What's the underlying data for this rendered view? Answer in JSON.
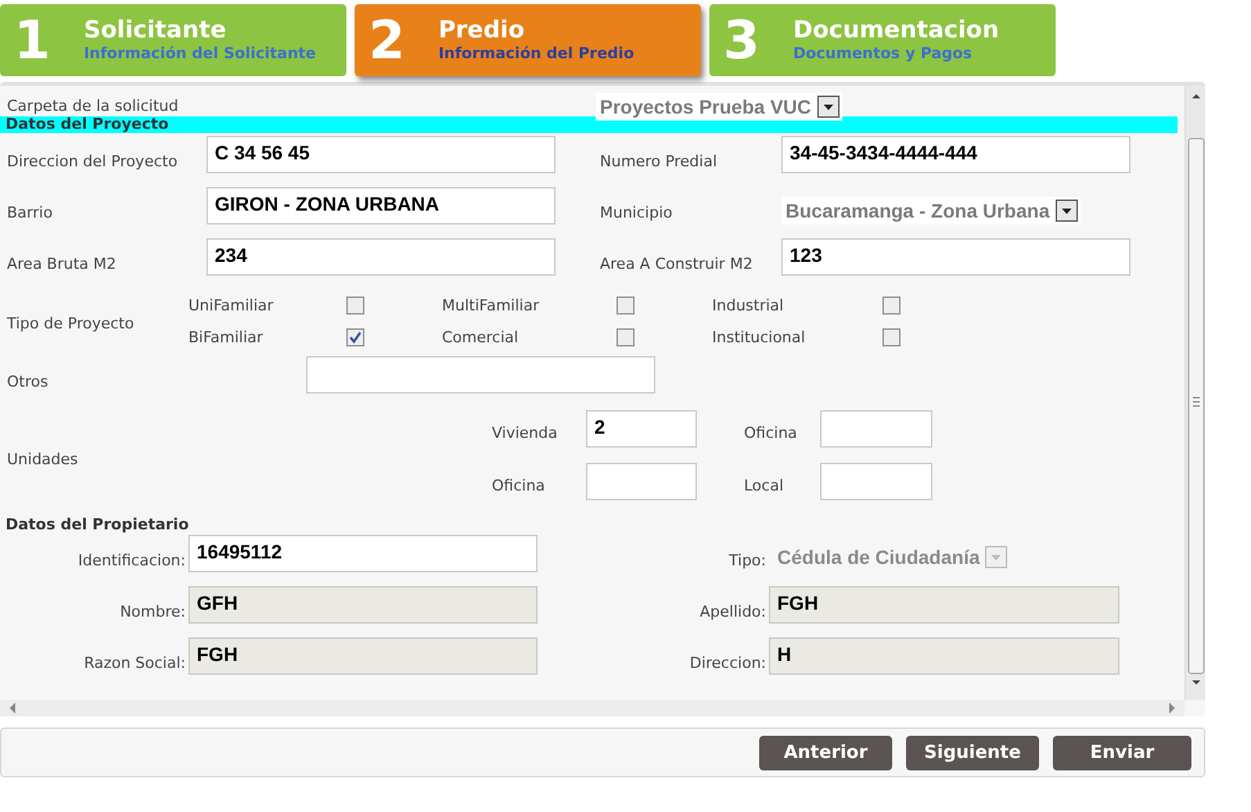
{
  "steps": [
    {
      "number": "1",
      "title": "Solicitante",
      "subtitle": "Información del Solicitante",
      "selected": false
    },
    {
      "number": "2",
      "title": "Predio",
      "subtitle": "Información del Predio",
      "selected": true
    },
    {
      "number": "3",
      "title": "Documentacion",
      "subtitle": "Documentos y Pagos",
      "selected": false
    }
  ],
  "carpeta": {
    "label": "Carpeta de la solicitud",
    "value": "Proyectos Prueba VUC"
  },
  "proyecto": {
    "heading": "Datos del Proyecto",
    "fields": [
      {
        "label": "Direccion del Proyecto",
        "kind": "text",
        "value": "C 34 56 45"
      },
      {
        "label": "Numero Predial",
        "kind": "text",
        "value": "34-45-3434-4444-444"
      },
      {
        "label": "Barrio",
        "kind": "text",
        "value": "GIRON - ZONA URBANA"
      },
      {
        "label": "Municipio",
        "kind": "select",
        "value": "Bucaramanga - Zona Urbana"
      },
      {
        "label": "Area Bruta M2",
        "kind": "text",
        "value": "234"
      },
      {
        "label": "Area A Construir M2",
        "kind": "text",
        "value": "123"
      }
    ],
    "tipo": {
      "label": "Tipo de Proyecto",
      "options": [
        {
          "label": "UniFamiliar",
          "checked": false
        },
        {
          "label": "MultiFamiliar",
          "checked": false
        },
        {
          "label": "Industrial",
          "checked": false
        },
        {
          "label": "BiFamiliar",
          "checked": true
        },
        {
          "label": "Comercial",
          "checked": false
        },
        {
          "label": "Institucional",
          "checked": false
        }
      ]
    },
    "otros": {
      "label": "Otros"
    },
    "unidades": {
      "label": "Unidades",
      "fields": [
        {
          "label": "Vivienda",
          "value": "2"
        },
        {
          "label": "Oficina"
        },
        {
          "label": "Oficina"
        },
        {
          "label": "Local"
        }
      ]
    }
  },
  "propietario": {
    "heading": "Datos del Propietario",
    "fields": [
      {
        "label": "Identificacion:",
        "kind": "text",
        "value": "16495112",
        "disabled": false
      },
      {
        "label": "Tipo:",
        "kind": "select",
        "value": "Cédula de Ciudadanía",
        "disabled": true
      },
      {
        "label": "Nombre:",
        "kind": "text",
        "value": "GFH",
        "disabled": true
      },
      {
        "label": "Apellido:",
        "kind": "text",
        "value": "FGH",
        "disabled": true
      },
      {
        "label": "Razon Social:",
        "kind": "text",
        "value": "FGH",
        "disabled": true
      },
      {
        "label": "Direccion:",
        "kind": "text",
        "value": "H",
        "disabled": true
      }
    ]
  },
  "buttons": [
    "Anterior",
    "Siguiente",
    "Enviar"
  ]
}
